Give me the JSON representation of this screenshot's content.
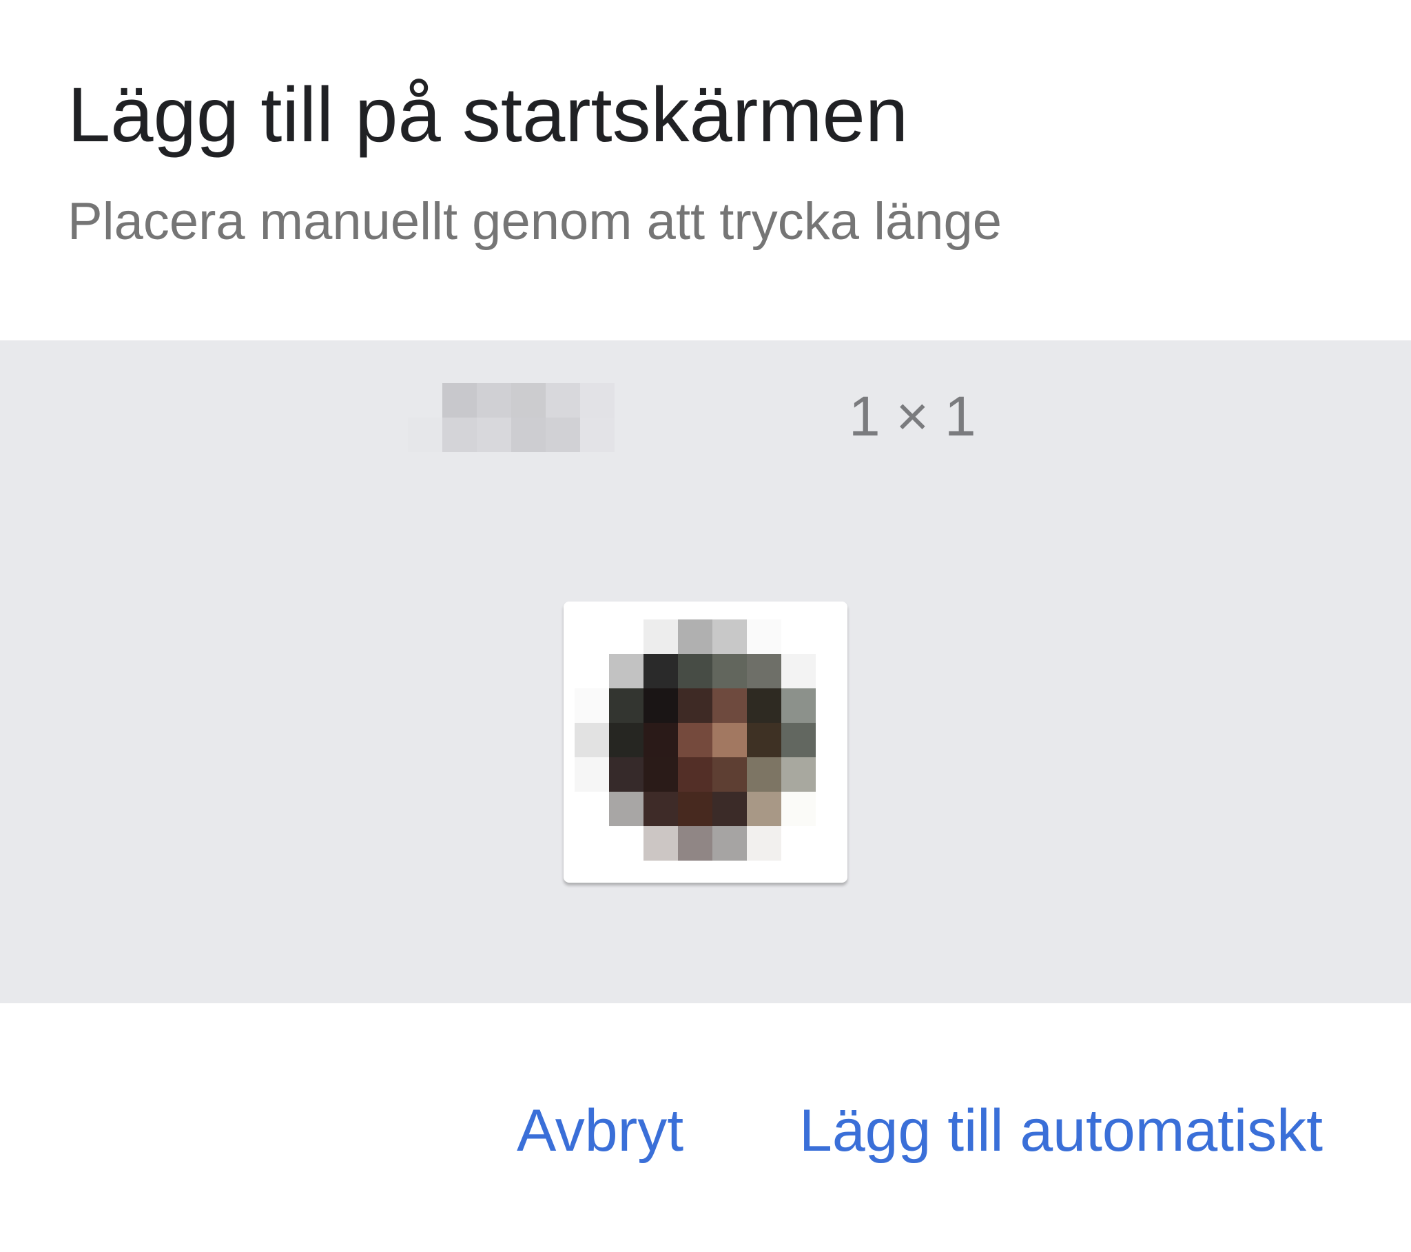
{
  "dialog": {
    "title": "Lägg till på startskärmen",
    "subtitle": "Placera manuellt genom att trycka länge"
  },
  "widget": {
    "size_label": "1 × 1",
    "label_blurred_colors": [
      "#e8e9ec",
      "#c8c8cc",
      "#d0d0d4",
      "#cccccf",
      "#d8d8dc",
      "#e2e2e6",
      "#e6e7ea",
      "#d4d4d8",
      "#d8d8dc",
      "#cdcdd1",
      "#d1d1d5",
      "#e3e3e7"
    ],
    "avatar_colors": [
      "#ffffff",
      "#ffffff",
      "#ededed",
      "#b0b0b0",
      "#c8c8c8",
      "#fafafa",
      "#ffffff",
      "#ffffff",
      "#c2c2c2",
      "#2a2a2a",
      "#474c45",
      "#62665d",
      "#6e6f68",
      "#f3f3f3",
      "#fafafa",
      "#333530",
      "#1a1515",
      "#3e2a25",
      "#6e4a3e",
      "#2e2a22",
      "#8c918b",
      "#e2e2e2",
      "#262622",
      "#2a1a18",
      "#754a3d",
      "#a27861",
      "#3e3124",
      "#626760",
      "#f6f6f6",
      "#362a2a",
      "#2a1b18",
      "#532f27",
      "#5e3f33",
      "#7d7564",
      "#a8a89f",
      "#ffffff",
      "#a8a6a5",
      "#3e2b28",
      "#47291f",
      "#3b2b28",
      "#a89886",
      "#fbfbf8",
      "#ffffff",
      "#ffffff",
      "#ccc6c4",
      "#908685",
      "#a6a4a3",
      "#f2f0ee",
      "#ffffff"
    ]
  },
  "actions": {
    "cancel_label": "Avbryt",
    "add_auto_label": "Lägg till automatiskt"
  },
  "colors": {
    "accent": "#3a6fd8",
    "panel_background": "#e8e9ec",
    "title": "#202124",
    "subtitle": "#757575"
  }
}
